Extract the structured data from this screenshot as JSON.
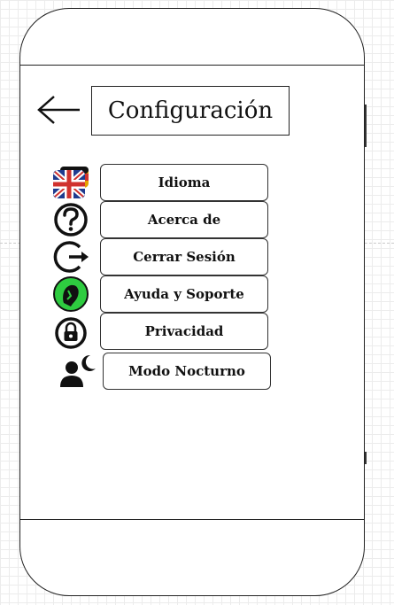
{
  "header": {
    "back_icon": "arrow-left-icon",
    "title": "Configuración"
  },
  "menu": {
    "items": [
      {
        "id": "idioma",
        "label": "Idioma",
        "icon": "language-flag-icon"
      },
      {
        "id": "acerca",
        "label": "Acerca de",
        "icon": "question-icon"
      },
      {
        "id": "cerrar",
        "label": "Cerrar Sesión",
        "icon": "logout-icon"
      },
      {
        "id": "ayuda",
        "label": "Ayuda y Soporte",
        "icon": "support-headset-icon"
      },
      {
        "id": "privacidad",
        "label": "Privacidad",
        "icon": "lock-icon"
      },
      {
        "id": "nocturno",
        "label": "Modo Nocturno",
        "icon": "night-mode-icon"
      }
    ]
  },
  "colors": {
    "frame": "#222222",
    "support_green": "#2ecc40",
    "flag_blue": "#1f3b8f",
    "flag_red": "#d0312d"
  }
}
